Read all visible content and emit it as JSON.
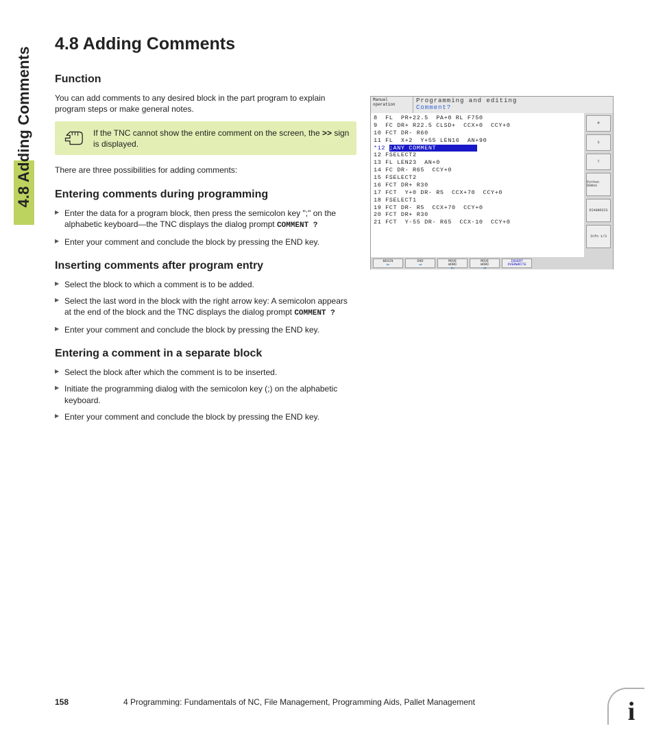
{
  "side_tab": "4.8 Adding Comments",
  "title": "4.8   Adding Comments",
  "sub_function": "Function",
  "p_intro": "You can add comments to any desired block in the part program to explain program steps or make general notes.",
  "callout": {
    "text_before": "If the TNC cannot show the entire comment on the screen, the ",
    "symbol": ">>",
    "text_after": " sign is displayed."
  },
  "p_three": "There are three possibilities for adding comments:",
  "sub_during": "Entering comments during programming",
  "steps_during": [
    {
      "before": "Enter the data for a program block, then press the semicolon key \";\" on the alphabetic keyboard—the TNC displays the dialog prompt ",
      "mono": "COMMENT ?"
    },
    {
      "before": "Enter your comment and conclude the block by pressing the END key."
    }
  ],
  "sub_after": "Inserting comments after program entry",
  "steps_after": [
    {
      "before": "Select the block to which a comment is to be added."
    },
    {
      "before": "Select the last word in the block with the right arrow key: A semicolon appears at the end of the block and the TNC displays the dialog prompt ",
      "mono": "COMMENT ?"
    },
    {
      "before": "Enter your comment and conclude the block by pressing the END key."
    }
  ],
  "sub_separate": "Entering a comment in a separate block",
  "steps_separate": [
    {
      "before": "Select the block after which the comment is to be inserted."
    },
    {
      "before": "Initiate the programming dialog with the semicolon key (;) on the alphabetic keyboard."
    },
    {
      "before": "Enter your comment and conclude the block by pressing the END key."
    }
  ],
  "screenshot": {
    "mode": "Manual\noperation",
    "title1": "Programming and editing",
    "title2": "Comment?",
    "lines": [
      "8  FL  PR+22.5  PA+0 RL F750",
      "9  FC DR+ R22.5 CLSD+  CCX+0  CCY+0",
      "10 FCT DR- R60",
      "11 FL  X+2  Y+55 LEN16  AN+90",
      "HL:*12 ;ANY COMMENT",
      "12 FSELECT2",
      "13 FL LEN23  AN+0",
      "14 FC DR- R65  CCY+0",
      "15 FSELECT2",
      "16 FCT DR+ R30",
      "17 FCT  Y+0 DR- R5  CCX+70  CCY+0",
      "18 FSELECT1",
      "19 FCT DR- R5  CCX+70  CCY+0",
      "20 FCT DR+ R30",
      "21 FCT  Y-55 DR- R65  CCX-10  CCY+0"
    ],
    "side_buttons": [
      "M",
      "S",
      "T",
      "Python\nDemos",
      "DIAGNOSIS",
      "Info 1/3"
    ],
    "bottom_buttons": [
      {
        "label": "BEGIN",
        "arrow": "⇐",
        "color": "blue"
      },
      {
        "label": "END",
        "arrow": "⇒",
        "color": "blue"
      },
      {
        "label": "MOVE\nWORD",
        "arrow": "⇐",
        "color": "blue"
      },
      {
        "label": "MOVE\nWORD",
        "arrow": "⇒",
        "color": "blue"
      },
      {
        "label": "INSERT\nOVERWRITE",
        "class": "insert"
      }
    ]
  },
  "footer": {
    "page": "158",
    "text": "4 Programming: Fundamentals of NC, File Management, Programming Aids, Pallet Management"
  },
  "info_glyph": "i"
}
